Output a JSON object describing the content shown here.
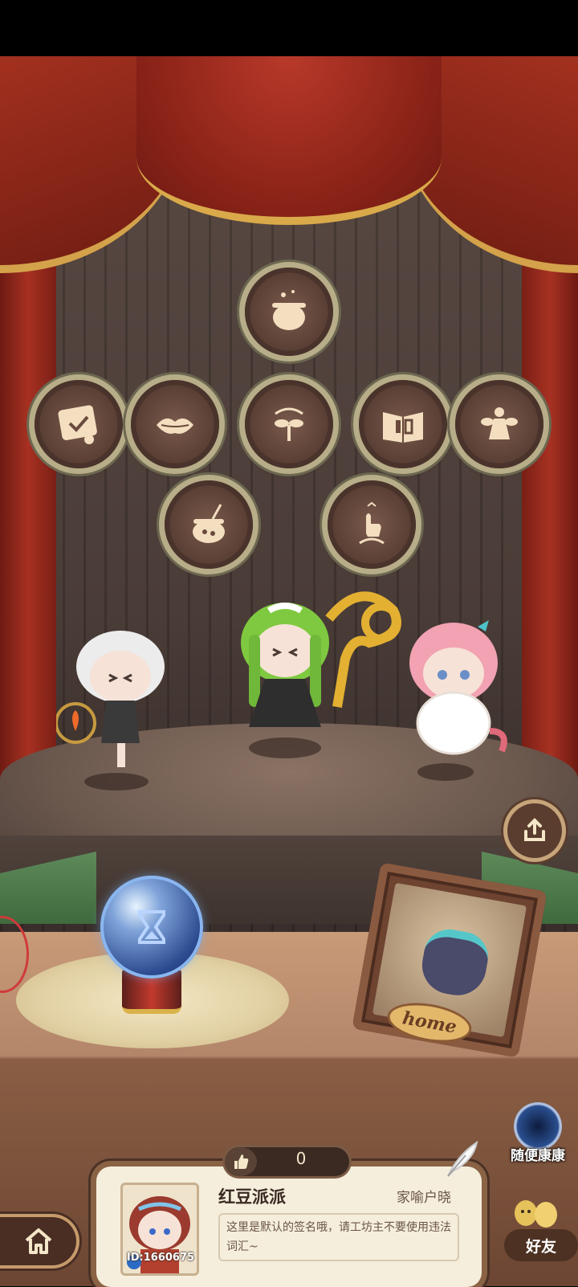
{
  "stage": {
    "badges": [
      {
        "name": "cauldron-badge-top",
        "icon": "cauldron-icon"
      },
      {
        "name": "scroll-check-badge",
        "icon": "scroll-check-icon"
      },
      {
        "name": "lips-badge",
        "icon": "lips-icon"
      },
      {
        "name": "sprout-badge",
        "icon": "sprout-icon"
      },
      {
        "name": "book-badge",
        "icon": "book-icon"
      },
      {
        "name": "fairy-badge",
        "icon": "fairy-icon"
      },
      {
        "name": "pot-badge",
        "icon": "pot-icon"
      },
      {
        "name": "hand-plant-badge",
        "icon": "hand-plant-icon"
      }
    ]
  },
  "frame": {
    "label": "home"
  },
  "random_visit": {
    "label": "随便康康"
  },
  "likes": {
    "count": "0"
  },
  "profile": {
    "name": "红豆派派",
    "home_title": "家喻户晓",
    "signature": "这里是默认的签名哦，请工坊主不要使用违法词汇~",
    "id": "ID:1660675"
  },
  "friends": {
    "label": "好友"
  },
  "colors": {
    "accent": "#c79a6b",
    "card": "#f5eedc",
    "curtain": "#8e2419"
  }
}
